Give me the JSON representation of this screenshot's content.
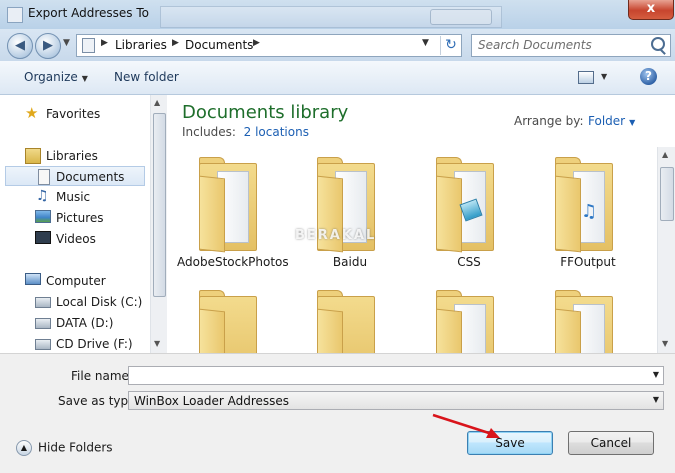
{
  "window": {
    "title": "Export Addresses To",
    "close_label": "x"
  },
  "address_bar": {
    "breadcrumbs": [
      "Libraries",
      "Documents"
    ],
    "search_placeholder": "Search Documents"
  },
  "toolbar": {
    "organize": "Organize",
    "new_folder": "New folder"
  },
  "sidebar": {
    "items": [
      {
        "label": "Favorites",
        "icon": "star-icon"
      },
      {
        "label": "Libraries",
        "icon": "library-icon"
      },
      {
        "label": "Documents",
        "icon": "documents-icon",
        "selected": true
      },
      {
        "label": "Music",
        "icon": "music-icon"
      },
      {
        "label": "Pictures",
        "icon": "pictures-icon"
      },
      {
        "label": "Videos",
        "icon": "videos-icon"
      },
      {
        "label": "Computer",
        "icon": "computer-icon"
      },
      {
        "label": "Local Disk (C:)",
        "icon": "drive-icon"
      },
      {
        "label": "DATA (D:)",
        "icon": "drive-icon"
      },
      {
        "label": "CD Drive (F:)",
        "icon": "cd-drive-icon"
      }
    ]
  },
  "content": {
    "library_title": "Documents library",
    "includes_prefix": "Includes:",
    "includes_link": "2 locations",
    "arrange_label": "Arrange by:",
    "arrange_value": "Folder",
    "items": [
      {
        "label": "AdobeStockPhotos"
      },
      {
        "label": "Baidu"
      },
      {
        "label": "CSS"
      },
      {
        "label": "FFOutput"
      }
    ],
    "watermark": "BERAKAL"
  },
  "form": {
    "file_name_label": "File name:",
    "file_name_value": "",
    "save_type_label": "Save as type:",
    "save_type_value": "WinBox Loader Addresses"
  },
  "footer": {
    "hide_folders": "Hide Folders",
    "save": "Save",
    "cancel": "Cancel"
  },
  "colors": {
    "accent_link": "#1c5fb3",
    "library_title": "#1e6e2b",
    "annotation_arrow": "#d9141b"
  }
}
